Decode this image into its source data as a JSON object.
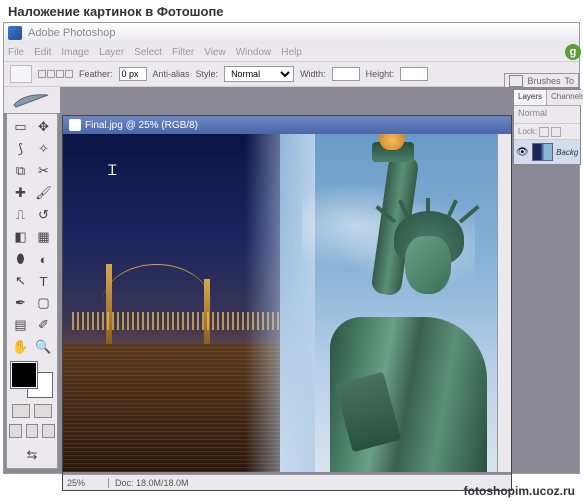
{
  "page": {
    "title": "Наложение картинок в Фотошопе",
    "footer_url": "fotoshopim.ucoz.ru"
  },
  "app": {
    "title": "Adobe Photoshop"
  },
  "menu": {
    "items": [
      "File",
      "Edit",
      "Image",
      "Layer",
      "Select",
      "Filter",
      "View",
      "Window",
      "Help"
    ]
  },
  "options": {
    "feather_label": "Feather:",
    "feather_value": "0 px",
    "antialias": "Anti-alias",
    "style_label": "Style:",
    "style_value": "Normal",
    "width_label": "Width:",
    "height_label": "Height:"
  },
  "document": {
    "title": "Final.jpg @ 25% (RGB/8)",
    "zoom": "25%",
    "info": "Doc: 18.0M/18.0M"
  },
  "panels": {
    "tabs": [
      "Layers",
      "Channels"
    ],
    "blend_mode": "Normal",
    "lock_label": "Lock:",
    "layer": {
      "name": "Backgro",
      "visible": true
    }
  },
  "brushes": {
    "label": "Brushes",
    "tool": "To"
  },
  "watermark": "g"
}
